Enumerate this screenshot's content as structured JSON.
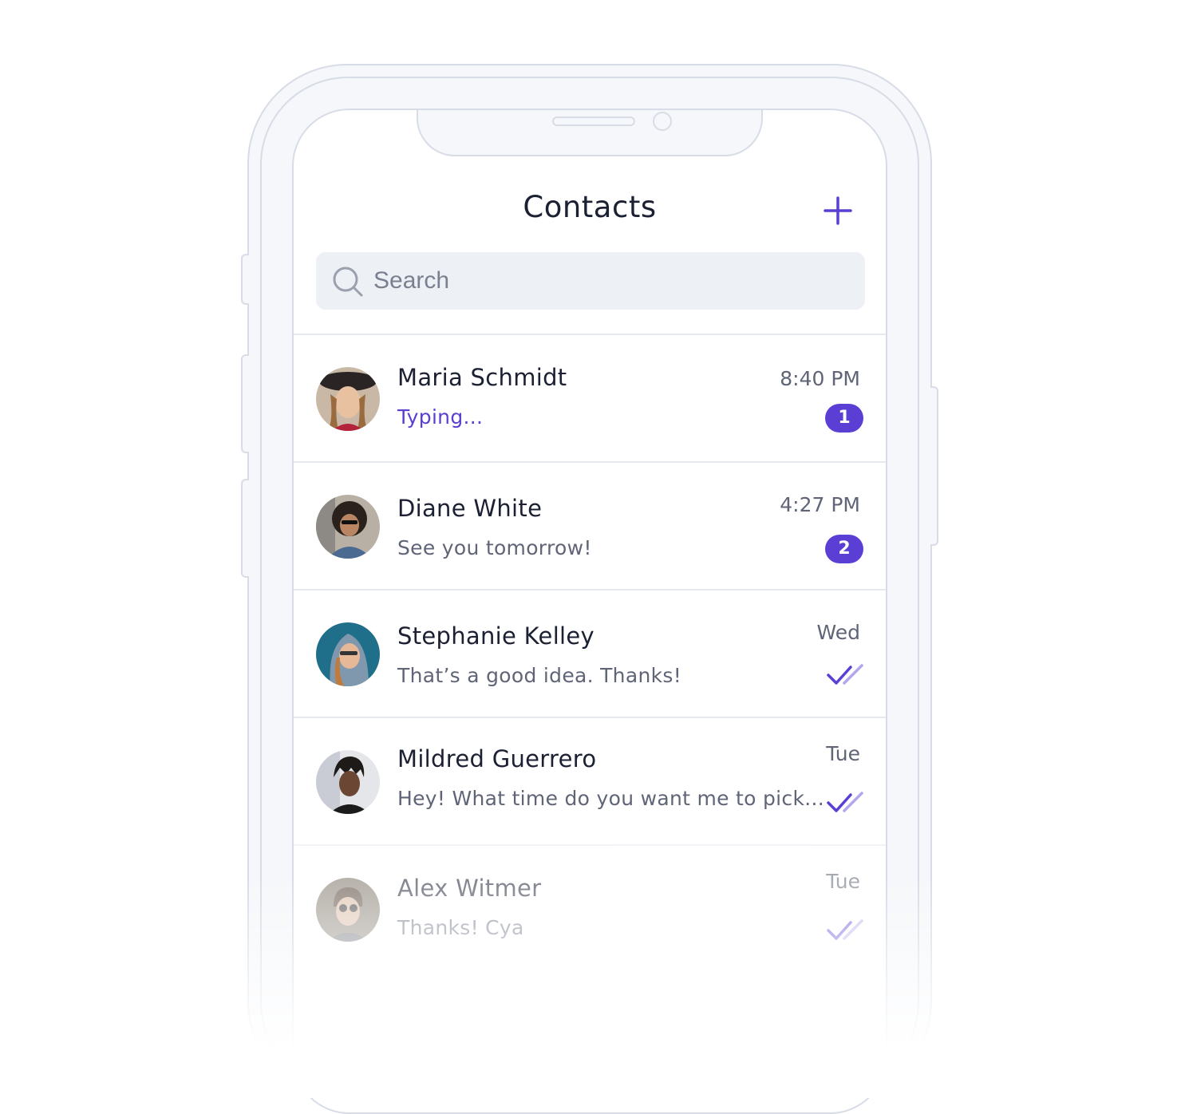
{
  "header": {
    "title": "Contacts",
    "add_icon": "plus-icon"
  },
  "search": {
    "placeholder": "Search",
    "icon": "search-icon"
  },
  "colors": {
    "accent": "#5b3fd4",
    "text_primary": "#1b2033",
    "text_secondary": "#5f6577",
    "search_bg": "#edf0f5",
    "frame": "#d7dce6"
  },
  "contacts": [
    {
      "name": "Maria Schmidt",
      "preview": "Typing...",
      "time": "8:40 PM",
      "unread": "1",
      "status": "typing"
    },
    {
      "name": "Diane White",
      "preview": "See you tomorrow!",
      "time": "4:27 PM",
      "unread": "2",
      "status": "unread"
    },
    {
      "name": "Stephanie Kelley",
      "preview": "That’s a good idea. Thanks!",
      "time": "Wed",
      "status": "read",
      "status_icon": "double-check-icon"
    },
    {
      "name": "Mildred Guerrero",
      "preview": "Hey! What time do you want me to pick...",
      "time": "Tue",
      "status": "read",
      "status_icon": "double-check-icon"
    },
    {
      "name": "Alex Witmer",
      "preview": "Thanks! Cya",
      "time": "Tue",
      "status": "read",
      "status_icon": "double-check-icon"
    }
  ]
}
